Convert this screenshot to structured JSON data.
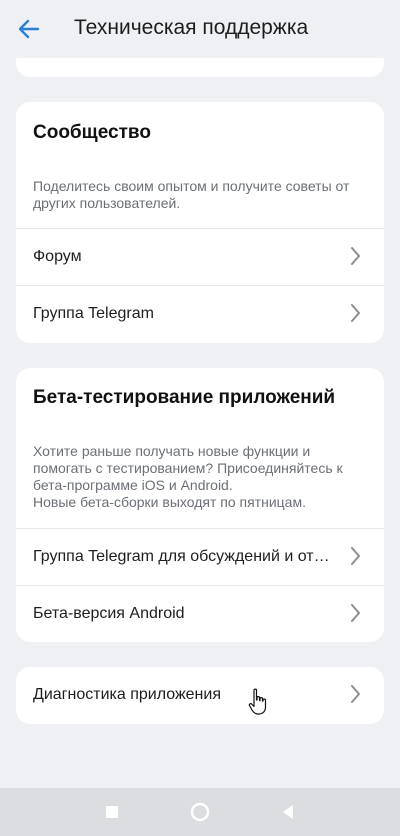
{
  "header": {
    "title": "Техническая поддержка",
    "back_icon": "back-arrow-icon",
    "accent": "#2a7fd4"
  },
  "community": {
    "title": "Сообщество",
    "description": "Поделитесь своим опытом и получите советы от других пользователей.",
    "items": [
      {
        "label": "Форум"
      },
      {
        "label": "Группа Telegram"
      }
    ]
  },
  "beta": {
    "title": "Бета-тестирование приложений",
    "description_lines": [
      "Хотите раньше получать новые функции и помогать с тестированием? Присоединяйтесь к бета-программе iOS и Android.",
      "Новые бета-сборки выходят по пятницам."
    ],
    "items": [
      {
        "label": "Группа Telegram для обсуждений и отзывов"
      },
      {
        "label": "Бета-версия Android"
      }
    ]
  },
  "diagnostics": {
    "label": "Диагностика приложения"
  },
  "navbar": {
    "buttons": [
      "square-recents-icon",
      "circle-home-icon",
      "triangle-back-icon"
    ]
  }
}
